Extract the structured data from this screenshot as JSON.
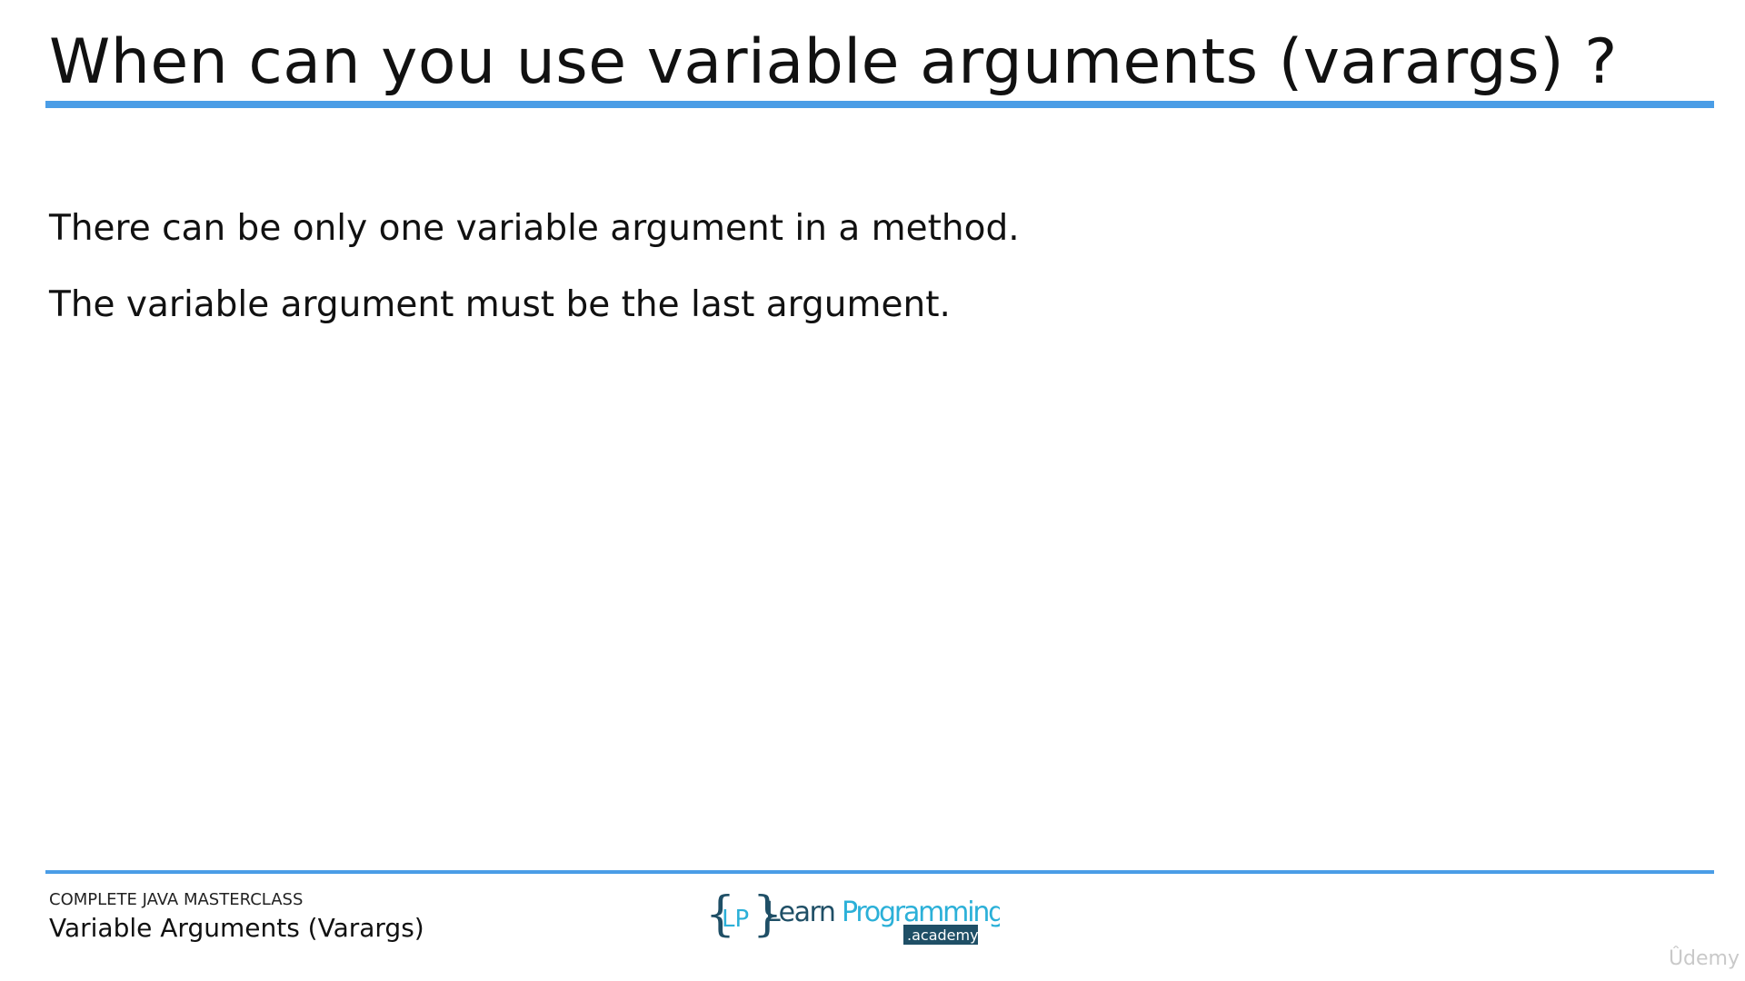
{
  "slide": {
    "title": "When can you use variable arguments (varargs) ?",
    "bullets": [
      "There can be only one variable argument in a method.",
      "The variable argument must be the last argument."
    ]
  },
  "footer": {
    "course": "COMPLETE JAVA MASTERCLASS",
    "topic": "Variable Arguments (Varargs)",
    "logo": {
      "brace_open": "{",
      "initials": "LP",
      "brace_close": "}",
      "word_learn": "Learn",
      "word_programming": "Programming",
      "tag": ".academy"
    }
  },
  "watermark": "Ûdemy",
  "colors": {
    "rule": "#4a9de6",
    "logo_dark": "#1f4f66",
    "logo_accent": "#2bb0d8"
  }
}
